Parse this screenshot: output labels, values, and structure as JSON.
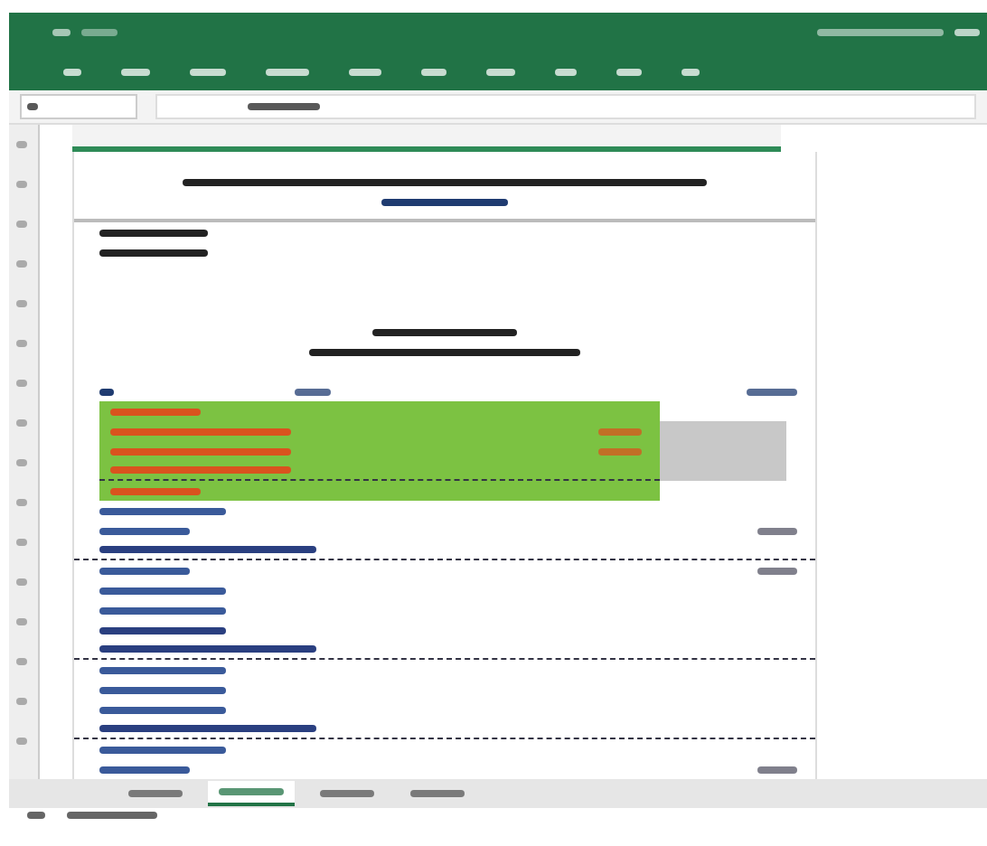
{
  "ribbon": {
    "tabs": [
      {
        "selected": false
      },
      {
        "selected": false
      },
      {
        "selected": false
      },
      {
        "selected": false
      },
      {
        "selected": false
      },
      {
        "selected": false
      },
      {
        "selected": false
      },
      {
        "selected": false
      },
      {
        "selected": false
      },
      {
        "selected": false
      }
    ]
  },
  "sheet_rows": [
    {
      "kind": "blank"
    },
    {
      "kind": "title",
      "color": "#222222"
    },
    {
      "kind": "title-short",
      "color": "#1f3b70"
    },
    {
      "kind": "rule"
    },
    {
      "kind": "info",
      "color": "#222222"
    },
    {
      "kind": "info",
      "color": "#222222"
    },
    {
      "kind": "blank"
    },
    {
      "kind": "blank"
    },
    {
      "kind": "blank"
    },
    {
      "kind": "subtitle",
      "color": "#222222"
    },
    {
      "kind": "subtitle-long",
      "color": "#222222"
    },
    {
      "kind": "blank"
    },
    {
      "kind": "header",
      "color": "#1f3b70"
    },
    {
      "kind": "highlight",
      "color": "#d9531e"
    },
    {
      "kind": "highlight-amount",
      "color": "#d9531e"
    },
    {
      "kind": "highlight-amount",
      "color": "#d9531e"
    },
    {
      "kind": "highlight-dashed",
      "color": "#d9531e"
    },
    {
      "kind": "highlight",
      "color": "#d9531e"
    },
    {
      "kind": "line",
      "color": "#3a5a9a"
    },
    {
      "kind": "line-amount",
      "color": "#3a5a9a"
    },
    {
      "kind": "dashed",
      "color": "#2a3f80"
    },
    {
      "kind": "line-amount",
      "color": "#3a5a9a"
    },
    {
      "kind": "line",
      "color": "#3a5a9a"
    },
    {
      "kind": "line",
      "color": "#3a5a9a"
    },
    {
      "kind": "line",
      "color": "#2a3f80"
    },
    {
      "kind": "dashed",
      "color": "#2a3f80"
    },
    {
      "kind": "line",
      "color": "#3a5a9a"
    },
    {
      "kind": "line",
      "color": "#3a5a9a"
    },
    {
      "kind": "line",
      "color": "#3a5a9a"
    },
    {
      "kind": "dashed",
      "color": "#2a3f80"
    },
    {
      "kind": "line",
      "color": "#3a5a9a"
    },
    {
      "kind": "line-amount",
      "color": "#3a5a9a"
    }
  ],
  "sheet_tabs": [
    {
      "selected": false
    },
    {
      "selected": true
    },
    {
      "selected": false
    },
    {
      "selected": false
    }
  ]
}
